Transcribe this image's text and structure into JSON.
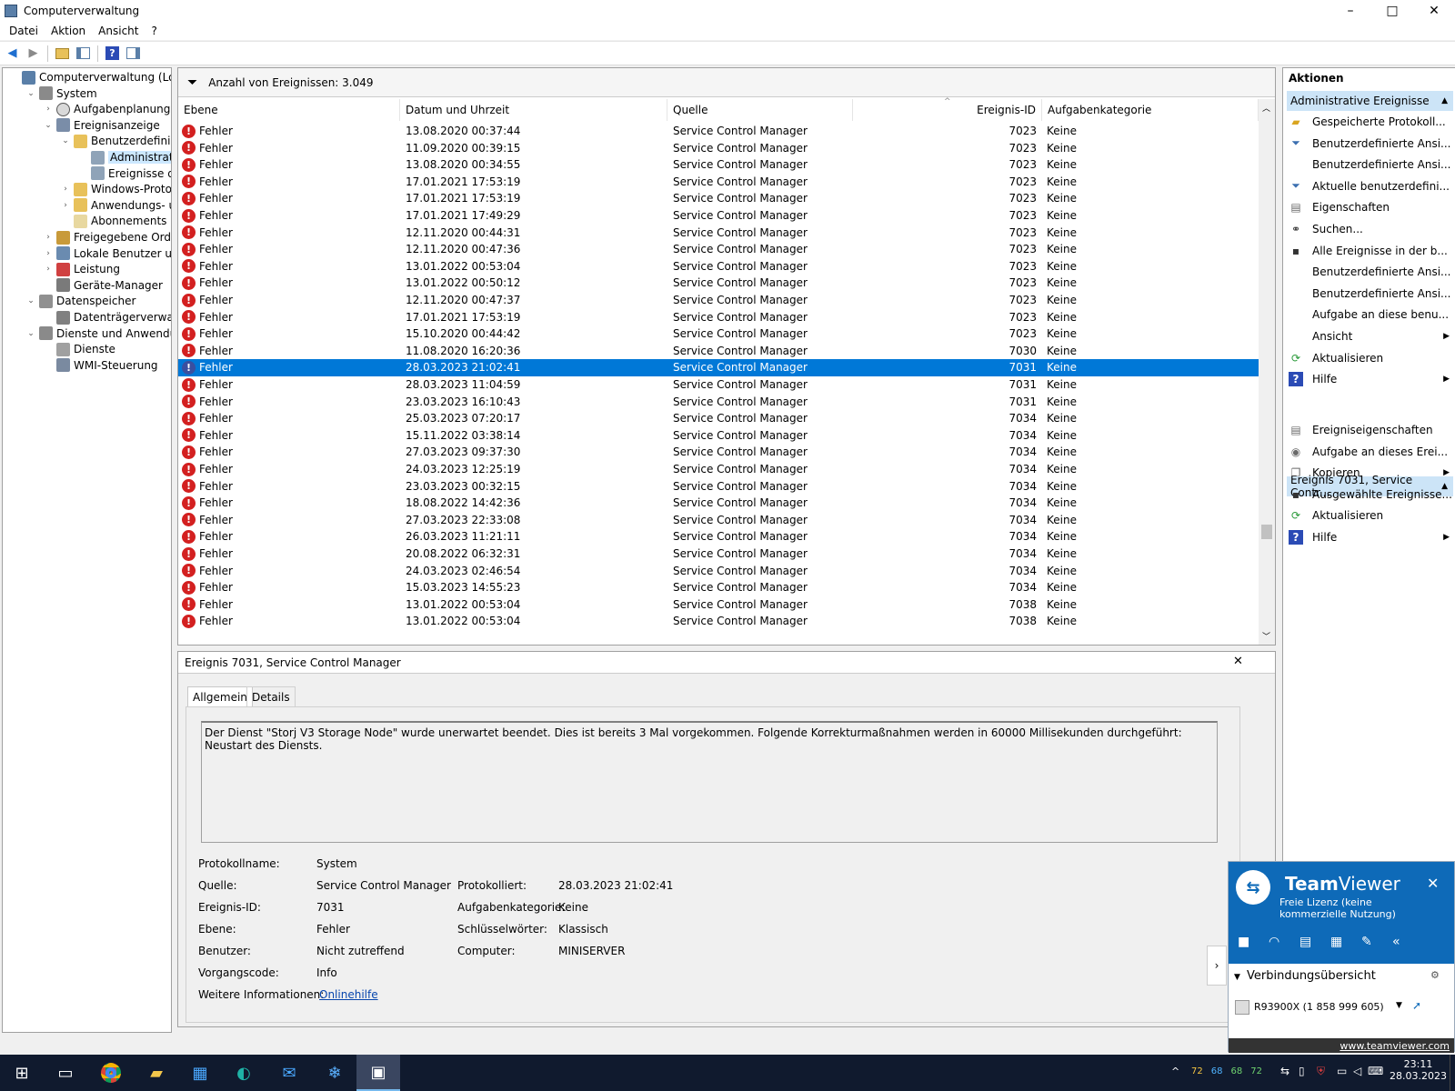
{
  "window": {
    "title": "Computerverwaltung",
    "min": "–",
    "max": "□",
    "close": "✕"
  },
  "menu": [
    "Datei",
    "Aktion",
    "Ansicht",
    "?"
  ],
  "tree": {
    "items": [
      {
        "label": "Computerverwaltung (Lokal)",
        "icon": "computer-mgmt-icon",
        "exp": ""
      },
      {
        "label": "System",
        "icon": "system-tools-icon",
        "exp": "⌄"
      },
      {
        "label": "Aufgabenplanung",
        "icon": "clock-icon",
        "exp": "›"
      },
      {
        "label": "Ereignisanzeige",
        "icon": "event-viewer-icon",
        "exp": "⌄"
      },
      {
        "label": "Benutzerdefinierte A",
        "icon": "folder-icon",
        "exp": "⌄"
      },
      {
        "label": "Administrative E",
        "icon": "filter-icon",
        "exp": ""
      },
      {
        "label": "Ereignisse der Zu",
        "icon": "filter-icon",
        "exp": ""
      },
      {
        "label": "Windows-Protokolle",
        "icon": "folder-icon",
        "exp": "›"
      },
      {
        "label": "Anwendungs- und D",
        "icon": "folder-icon",
        "exp": "›"
      },
      {
        "label": "Abonnements",
        "icon": "subscription-icon",
        "exp": ""
      },
      {
        "label": "Freigegebene Ordner",
        "icon": "shared-folder-icon",
        "exp": "›"
      },
      {
        "label": "Lokale Benutzer und Gru",
        "icon": "users-icon",
        "exp": "›"
      },
      {
        "label": "Leistung",
        "icon": "performance-icon",
        "exp": "›"
      },
      {
        "label": "Geräte-Manager",
        "icon": "device-manager-icon",
        "exp": ""
      },
      {
        "label": "Datenspeicher",
        "icon": "storage-icon",
        "exp": "⌄"
      },
      {
        "label": "Datenträgerverwaltung",
        "icon": "disk-icon",
        "exp": ""
      },
      {
        "label": "Dienste und Anwendungen",
        "icon": "services-apps-icon",
        "exp": "⌄"
      },
      {
        "label": "Dienste",
        "icon": "gear-icon",
        "exp": ""
      },
      {
        "label": "WMI-Steuerung",
        "icon": "wmi-icon",
        "exp": ""
      }
    ]
  },
  "events": {
    "count_label": "Anzahl von Ereignissen: 3.049",
    "columns": {
      "level": "Ebene",
      "date": "Datum und Uhrzeit",
      "source": "Quelle",
      "id": "Ereignis-ID",
      "category": "Aufgabenkategorie"
    },
    "rows": [
      {
        "level": "Fehler",
        "date": "13.08.2020 00:37:44",
        "source": "Service Control Manager",
        "id": "7023",
        "category": "Keine"
      },
      {
        "level": "Fehler",
        "date": "11.09.2020 00:39:15",
        "source": "Service Control Manager",
        "id": "7023",
        "category": "Keine"
      },
      {
        "level": "Fehler",
        "date": "13.08.2020 00:34:55",
        "source": "Service Control Manager",
        "id": "7023",
        "category": "Keine"
      },
      {
        "level": "Fehler",
        "date": "17.01.2021 17:53:19",
        "source": "Service Control Manager",
        "id": "7023",
        "category": "Keine"
      },
      {
        "level": "Fehler",
        "date": "17.01.2021 17:53:19",
        "source": "Service Control Manager",
        "id": "7023",
        "category": "Keine"
      },
      {
        "level": "Fehler",
        "date": "17.01.2021 17:49:29",
        "source": "Service Control Manager",
        "id": "7023",
        "category": "Keine"
      },
      {
        "level": "Fehler",
        "date": "12.11.2020 00:44:31",
        "source": "Service Control Manager",
        "id": "7023",
        "category": "Keine"
      },
      {
        "level": "Fehler",
        "date": "12.11.2020 00:47:36",
        "source": "Service Control Manager",
        "id": "7023",
        "category": "Keine"
      },
      {
        "level": "Fehler",
        "date": "13.01.2022 00:53:04",
        "source": "Service Control Manager",
        "id": "7023",
        "category": "Keine"
      },
      {
        "level": "Fehler",
        "date": "13.01.2022 00:50:12",
        "source": "Service Control Manager",
        "id": "7023",
        "category": "Keine"
      },
      {
        "level": "Fehler",
        "date": "12.11.2020 00:47:37",
        "source": "Service Control Manager",
        "id": "7023",
        "category": "Keine"
      },
      {
        "level": "Fehler",
        "date": "17.01.2021 17:53:19",
        "source": "Service Control Manager",
        "id": "7023",
        "category": "Keine"
      },
      {
        "level": "Fehler",
        "date": "15.10.2020 00:44:42",
        "source": "Service Control Manager",
        "id": "7023",
        "category": "Keine"
      },
      {
        "level": "Fehler",
        "date": "11.08.2020 16:20:36",
        "source": "Service Control Manager",
        "id": "7030",
        "category": "Keine"
      },
      {
        "level": "Fehler",
        "date": "28.03.2023 21:02:41",
        "source": "Service Control Manager",
        "id": "7031",
        "category": "Keine",
        "selected": true
      },
      {
        "level": "Fehler",
        "date": "28.03.2023 11:04:59",
        "source": "Service Control Manager",
        "id": "7031",
        "category": "Keine"
      },
      {
        "level": "Fehler",
        "date": "23.03.2023 16:10:43",
        "source": "Service Control Manager",
        "id": "7031",
        "category": "Keine"
      },
      {
        "level": "Fehler",
        "date": "25.03.2023 07:20:17",
        "source": "Service Control Manager",
        "id": "7034",
        "category": "Keine"
      },
      {
        "level": "Fehler",
        "date": "15.11.2022 03:38:14",
        "source": "Service Control Manager",
        "id": "7034",
        "category": "Keine"
      },
      {
        "level": "Fehler",
        "date": "27.03.2023 09:37:30",
        "source": "Service Control Manager",
        "id": "7034",
        "category": "Keine"
      },
      {
        "level": "Fehler",
        "date": "24.03.2023 12:25:19",
        "source": "Service Control Manager",
        "id": "7034",
        "category": "Keine"
      },
      {
        "level": "Fehler",
        "date": "23.03.2023 00:32:15",
        "source": "Service Control Manager",
        "id": "7034",
        "category": "Keine"
      },
      {
        "level": "Fehler",
        "date": "18.08.2022 14:42:36",
        "source": "Service Control Manager",
        "id": "7034",
        "category": "Keine"
      },
      {
        "level": "Fehler",
        "date": "27.03.2023 22:33:08",
        "source": "Service Control Manager",
        "id": "7034",
        "category": "Keine"
      },
      {
        "level": "Fehler",
        "date": "26.03.2023 11:21:11",
        "source": "Service Control Manager",
        "id": "7034",
        "category": "Keine"
      },
      {
        "level": "Fehler",
        "date": "20.08.2022 06:32:31",
        "source": "Service Control Manager",
        "id": "7034",
        "category": "Keine"
      },
      {
        "level": "Fehler",
        "date": "24.03.2023 02:46:54",
        "source": "Service Control Manager",
        "id": "7034",
        "category": "Keine"
      },
      {
        "level": "Fehler",
        "date": "15.03.2023 14:55:23",
        "source": "Service Control Manager",
        "id": "7034",
        "category": "Keine"
      },
      {
        "level": "Fehler",
        "date": "13.01.2022 00:53:04",
        "source": "Service Control Manager",
        "id": "7038",
        "category": "Keine"
      },
      {
        "level": "Fehler",
        "date": "13.01.2022 00:53:04",
        "source": "Service Control Manager",
        "id": "7038",
        "category": "Keine"
      }
    ]
  },
  "detail": {
    "title": "Ereignis 7031, Service Control Manager",
    "close": "✕",
    "tabs": {
      "general": "Allgemein",
      "details": "Details"
    },
    "message": "Der Dienst \"Storj V3 Storage Node\" wurde unerwartet beendet. Dies ist bereits 3 Mal vorgekommen. Folgende Korrekturmaßnahmen werden in 60000 Millisekunden durchgeführt: Neustart des Diensts.",
    "labels": {
      "logname": "Protokollname:",
      "source": "Quelle:",
      "eventid": "Ereignis-ID:",
      "level": "Ebene:",
      "user": "Benutzer:",
      "opcode": "Vorgangscode:",
      "moreinfo": "Weitere Informationen:",
      "logged": "Protokolliert:",
      "taskcat": "Aufgabenkategorie:",
      "keywords": "Schlüsselwörter:",
      "computer": "Computer:"
    },
    "values": {
      "logname": "System",
      "source": "Service Control Manager",
      "eventid": "7031",
      "level": "Fehler",
      "user": "Nicht zutreffend",
      "opcode": "Info",
      "moreinfo": "Onlinehilfe",
      "logged": "28.03.2023 21:02:41",
      "taskcat": "Keine",
      "keywords": "Klassisch",
      "computer": "MINISERVER"
    }
  },
  "actions": {
    "title": "Aktionen",
    "section1": "Administrative Ereignisse",
    "items1": [
      {
        "label": "Gespeicherte Protokoll...",
        "icon": "open-log-icon",
        "arrow": ""
      },
      {
        "label": "Benutzerdefinierte Ansi...",
        "icon": "filter-icon",
        "arrow": ""
      },
      {
        "label": "Benutzerdefinierte Ansi...",
        "icon": "",
        "arrow": ""
      },
      {
        "label": "Aktuelle benutzerdefini...",
        "icon": "filter-icon",
        "arrow": ""
      },
      {
        "label": "Eigenschaften",
        "icon": "properties-icon",
        "arrow": ""
      },
      {
        "label": "Suchen...",
        "icon": "binoculars-icon",
        "arrow": ""
      },
      {
        "label": "Alle Ereignisse in der b...",
        "icon": "save-icon",
        "arrow": ""
      },
      {
        "label": "Benutzerdefinierte Ansi...",
        "icon": "",
        "arrow": ""
      },
      {
        "label": "Benutzerdefinierte Ansi...",
        "icon": "",
        "arrow": ""
      },
      {
        "label": "Aufgabe an diese benu...",
        "icon": "",
        "arrow": ""
      },
      {
        "label": "Ansicht",
        "icon": "",
        "arrow": "▶"
      },
      {
        "label": "Aktualisieren",
        "icon": "refresh-icon",
        "arrow": ""
      },
      {
        "label": "Hilfe",
        "icon": "help-icon",
        "arrow": "▶"
      }
    ],
    "section2": "Ereignis 7031, Service Contr...",
    "items2": [
      {
        "label": "Ereigniseigenschaften",
        "icon": "properties-icon",
        "arrow": ""
      },
      {
        "label": "Aufgabe an dieses Erei...",
        "icon": "task-icon",
        "arrow": ""
      },
      {
        "label": "Kopieren",
        "icon": "copy-icon",
        "arrow": "▶"
      },
      {
        "label": "Ausgewählte Ereignisse...",
        "icon": "save-icon",
        "arrow": ""
      },
      {
        "label": "Aktualisieren",
        "icon": "refresh-icon",
        "arrow": ""
      },
      {
        "label": "Hilfe",
        "icon": "help-icon",
        "arrow": "▶"
      }
    ]
  },
  "teamviewer": {
    "brand_bold": "Team",
    "brand_rest": "Viewer",
    "license": "Freie Lizenz (keine kommerzielle Nutzung)",
    "overview": "Verbindungsübersicht",
    "device": "R93900X (1 858 999 605)",
    "link": "www.teamviewer.com",
    "close": "✕"
  },
  "taskbar": {
    "temps": [
      "72",
      "68",
      "68",
      "72"
    ],
    "temp_colors": [
      "#f4c542",
      "#4fb3ff",
      "#6fd36f",
      "#6fd36f"
    ],
    "time": "23:11",
    "date": "28.03.2023"
  },
  "colors": {
    "selection": "#0078d7",
    "error": "#d32020",
    "tv_blue": "#0e6ab8"
  }
}
